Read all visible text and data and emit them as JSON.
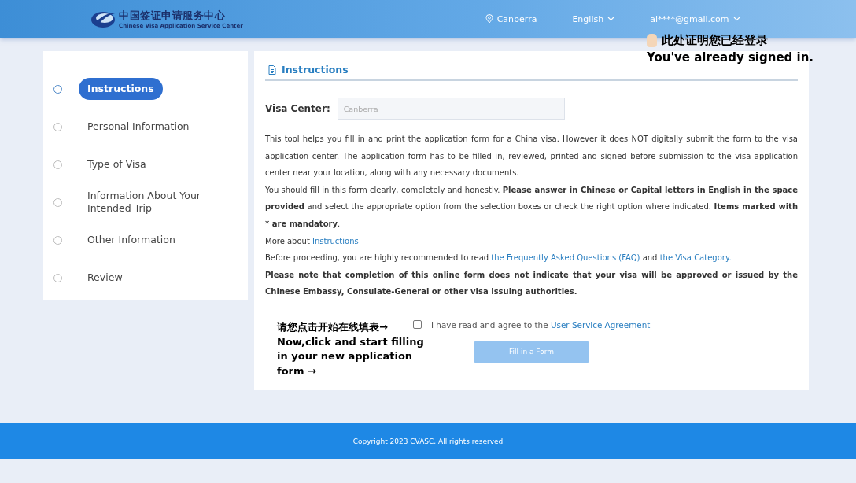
{
  "header": {
    "logo_cn": "中国签证申请服务中心",
    "logo_en": "Chinese Visa Application Service Center",
    "location": "Canberra",
    "language": "English",
    "account": "al****@gmail.com"
  },
  "steps": [
    {
      "label": "Instructions",
      "selected": true
    },
    {
      "label": "Personal Information",
      "selected": false
    },
    {
      "label": "Type of Visa",
      "selected": false
    },
    {
      "label": "Information About Your Intended Trip",
      "selected": false
    },
    {
      "label": "Other Information",
      "selected": false
    },
    {
      "label": "Review",
      "selected": false
    }
  ],
  "section_title": "Instructions",
  "visa_center": {
    "label": "Visa Center:",
    "placeholder": "Canberra"
  },
  "paragraphs": [
    [
      {
        "kind": "text",
        "text": "This tool helps you fill in and print the application form for a China visa. However it does NOT digitally submit the form to the visa application center. The application form has to be filled in, reviewed, printed and signed before submission to the visa application center near your location, along with any necessary documents."
      }
    ],
    [
      {
        "kind": "text",
        "text": "You should fill in this form clearly, completely and honestly. **Please answer in Chinese or Capital letters in English in the space provided** and select the appropriate option from the selection boxes or check the right option where indicated. **Items marked with * are mandatory**."
      }
    ],
    [
      {
        "kind": "text",
        "text": "More about "
      },
      {
        "kind": "link",
        "text": "Instructions"
      }
    ],
    [
      {
        "kind": "text",
        "text": "Before proceeding, you are highly recommended to read "
      },
      {
        "kind": "link",
        "text": "the Frequently Asked Questions (FAQ)"
      },
      {
        "kind": "text",
        "text": " and "
      },
      {
        "kind": "link",
        "text": "the Visa Category."
      }
    ],
    [
      {
        "kind": "text",
        "text": "**Please note that completion of this online form does not indicate that your visa will be approved or issued by the Chinese Embassy, Consulate-General or other visa issuing authorities.**"
      }
    ]
  ],
  "agreement": {
    "checked": false,
    "text": "I have read and agree to the ",
    "link": "User Service Agreement"
  },
  "fill_button": {
    "label": "Fill in a Form",
    "disabled": true
  },
  "signed_in_note": [
    "此处证明您已经登录",
    "You've already signed in."
  ],
  "start_note": [
    "请您点击开始在线填表→",
    "Now,click and start filling in your new application form →"
  ],
  "footer": "Copyright 2023 CVASC, All rights reserved"
}
